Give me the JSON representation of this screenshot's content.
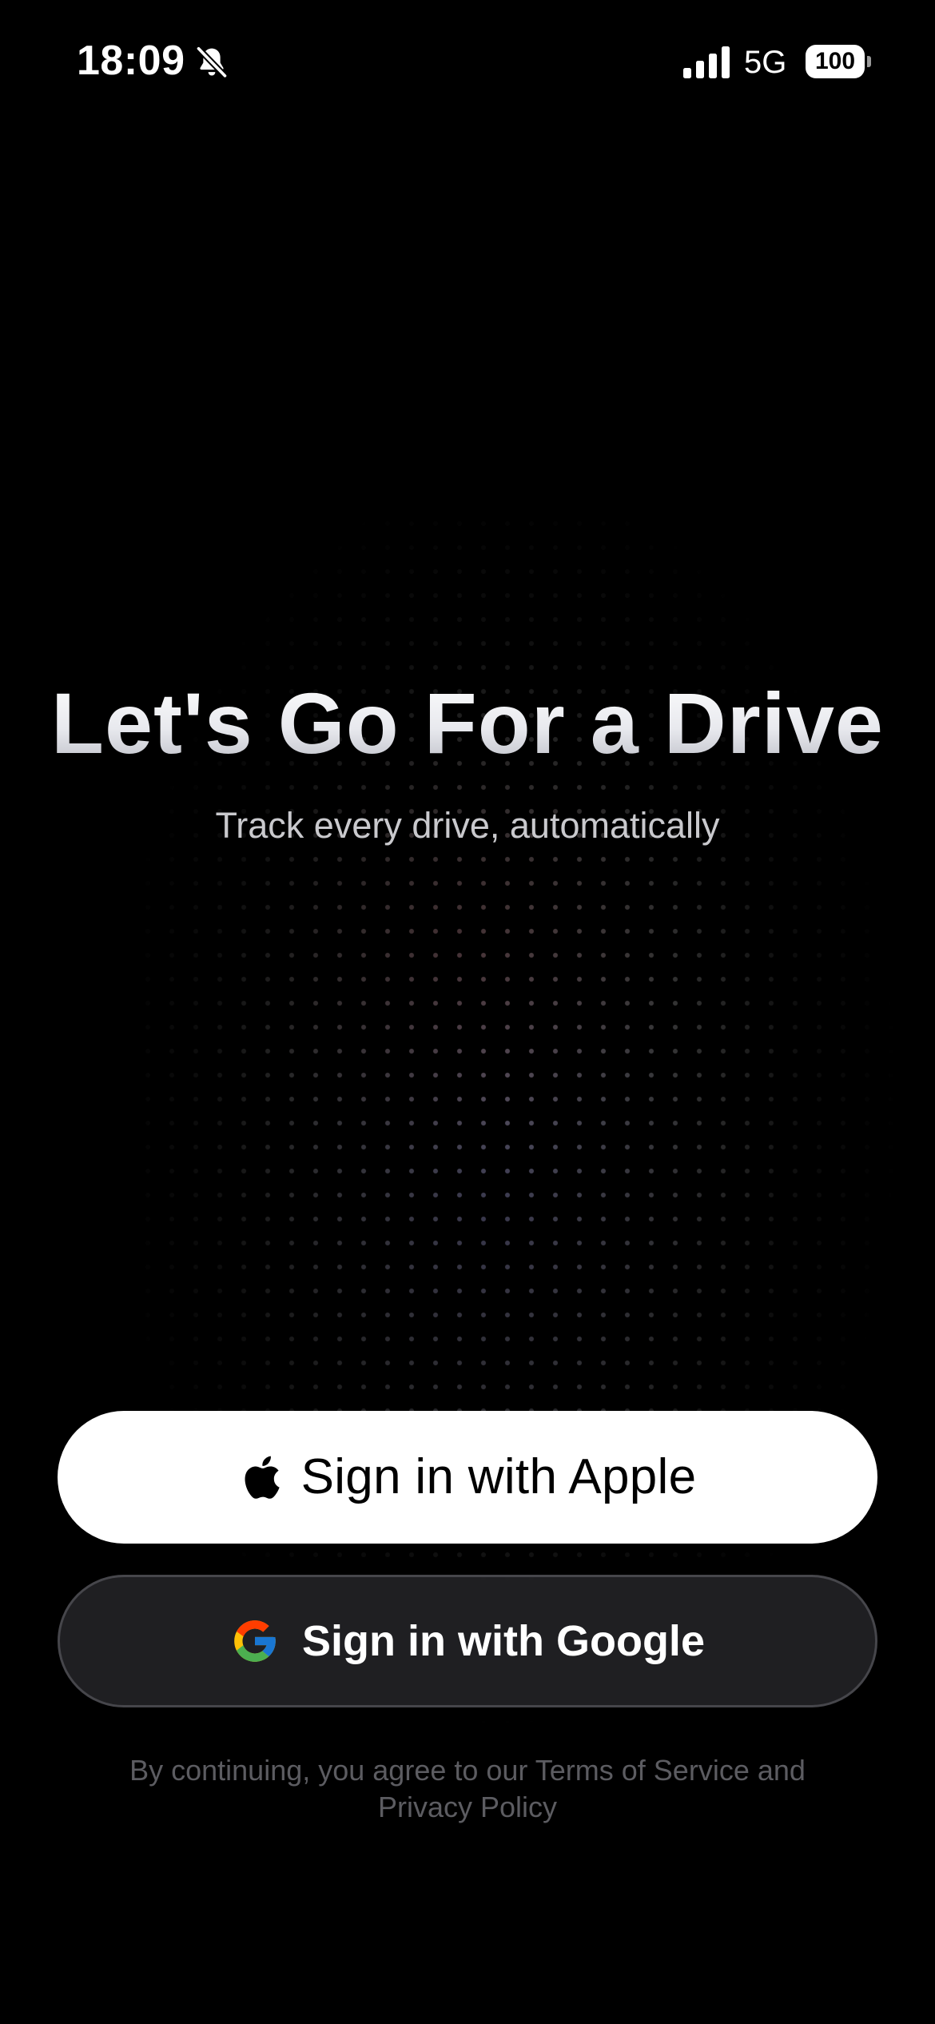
{
  "status_bar": {
    "time": "18:09",
    "network": "5G",
    "battery_level": "100",
    "icons": [
      "bell-slash-icon",
      "cellular-signal-icon",
      "battery-icon"
    ]
  },
  "hero": {
    "title": "Let's Go For a Drive",
    "subtitle": "Track every drive, automatically"
  },
  "buttons": {
    "apple_label": "Sign in with Apple",
    "google_label": "Sign in with Google"
  },
  "legal": {
    "text": "By continuing, you agree to our Terms of Service and Privacy Policy"
  },
  "colors": {
    "background": "#000000",
    "apple_button_bg": "#ffffff",
    "google_button_bg": "#222225",
    "google_button_border": "#46464b",
    "subtitle_text": "#c9c9cd",
    "legal_text": "#5c5c61"
  }
}
